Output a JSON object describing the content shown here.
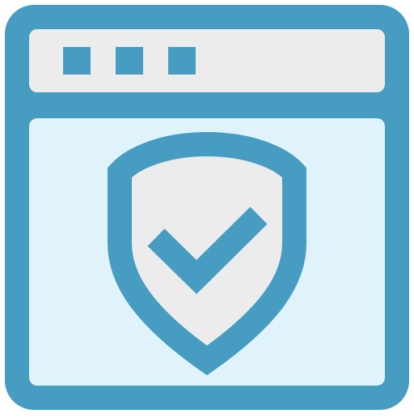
{
  "icon": {
    "name": "browser-window-security-shield-check-icon",
    "parts": {
      "window": "browser-window-icon",
      "dots": [
        "window-dot-icon",
        "window-dot-icon",
        "window-dot-icon"
      ],
      "shield": "shield-icon",
      "check": "checkmark-icon"
    }
  },
  "colors": {
    "stroke": "#469dc1",
    "titlebar_fill": "#ececec",
    "content_fill": "#e0f3fb",
    "shield_fill": "#ececec"
  }
}
